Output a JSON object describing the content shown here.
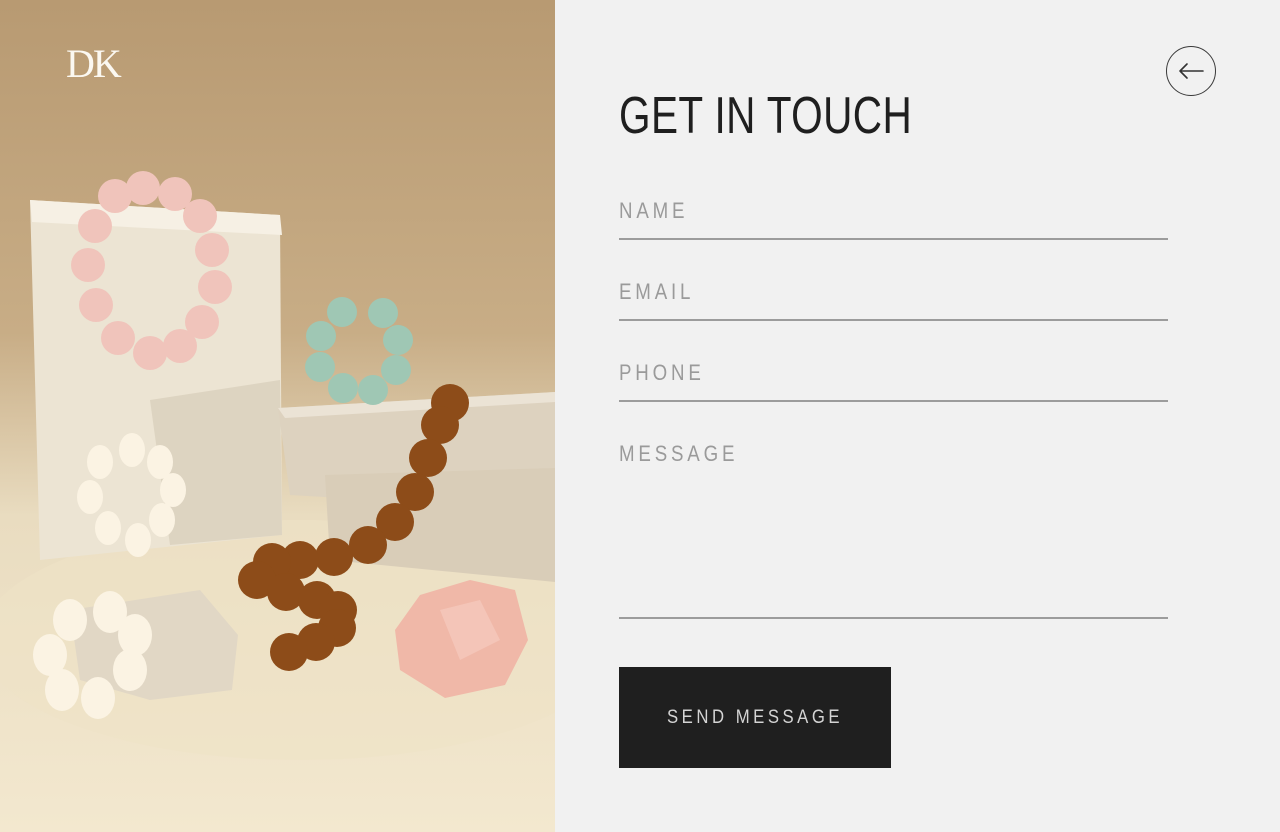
{
  "brand": {
    "logo_text": "DK"
  },
  "header": {
    "title": "GET IN TOUCH",
    "back_icon": "arrow-left-icon"
  },
  "form": {
    "name_placeholder": "NAME",
    "email_placeholder": "EMAIL",
    "phone_placeholder": "PHONE",
    "message_placeholder": "MESSAGE",
    "submit_label": "SEND MESSAGE"
  },
  "colors": {
    "panel_bg": "#f1f1f1",
    "button_bg": "#1f1f1f",
    "button_text": "#d4d4d4",
    "placeholder": "#9a9a9a",
    "underline": "#9c9c9c"
  }
}
